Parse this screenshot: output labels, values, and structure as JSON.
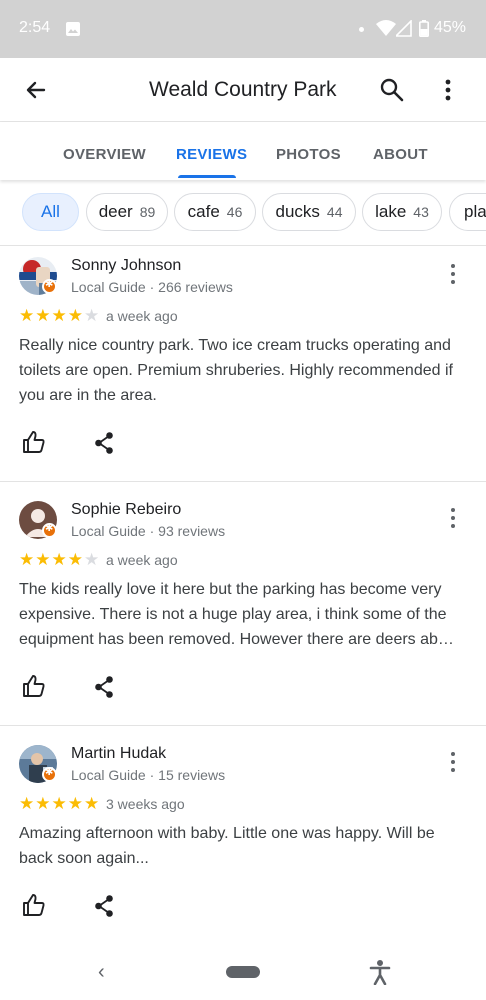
{
  "status_bar": {
    "time": "2:54",
    "battery": "45%"
  },
  "app_bar": {
    "title": "Weald Country Park"
  },
  "tabs": [
    {
      "label": "OVERVIEW",
      "active": false
    },
    {
      "label": "REVIEWS",
      "active": true
    },
    {
      "label": "PHOTOS",
      "active": false
    },
    {
      "label": "ABOUT",
      "active": false
    }
  ],
  "filters": [
    {
      "label": "All",
      "count": "",
      "selected": true
    },
    {
      "label": "deer",
      "count": "89"
    },
    {
      "label": "cafe",
      "count": "46"
    },
    {
      "label": "ducks",
      "count": "44"
    },
    {
      "label": "lake",
      "count": "43"
    },
    {
      "label": "pla",
      "count": ""
    }
  ],
  "reviews": [
    {
      "name": "Sonny Johnson",
      "meta": "Local Guide · 266 reviews",
      "rating": 4,
      "date": "a week ago",
      "text": "Really nice country park. Two ice cream trucks operating and toilets are open. Premium shruberies. Highly recommended if you are in the area."
    },
    {
      "name": "Sophie Rebeiro",
      "meta": "Local Guide · 93 reviews",
      "rating": 4,
      "date": "a week ago",
      "text": "The kids really love it here but the parking has become very expensive.  There is not a huge play area, i think some of the equipment has been removed. However there are deers ab…"
    },
    {
      "name": "Martin Hudak",
      "meta": "Local Guide · 15 reviews",
      "rating": 5,
      "date": "3 weeks ago",
      "text": "Amazing afternoon with baby. Little one was happy. Will be back soon again..."
    }
  ],
  "colors": {
    "accent": "#1a73e8",
    "star": "#fbbc04",
    "badge": "#e8710a"
  }
}
